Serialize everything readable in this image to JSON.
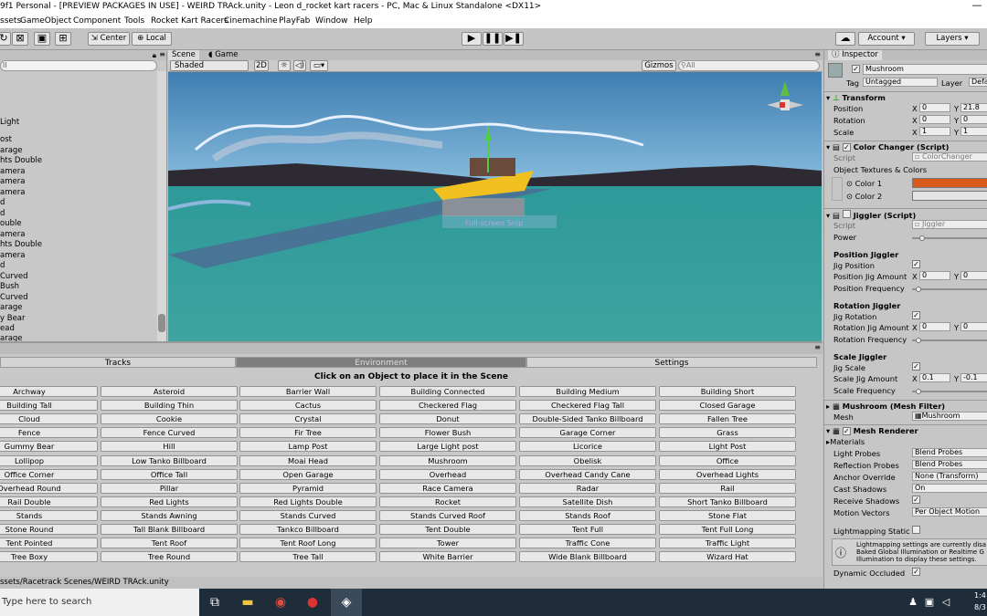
{
  "window": {
    "title": "9f1 Personal - [PREVIEW PACKAGES IN USE] - WEIRD TRAck.unity - Leon d_rocket kart racers - PC, Mac & Linux Standalone <DX11>",
    "minimize": "—"
  },
  "menu": [
    "ssets",
    "GameObject",
    "Component",
    "Tools",
    "Rocket Kart Racers",
    "Cinemachine",
    "PlayFab",
    "Window",
    "Help"
  ],
  "toolbar": {
    "center": "Center",
    "local": "Local",
    "account": "Account",
    "layers": "Layers",
    "dropdown_arrow": "▾"
  },
  "hierarchy": {
    "search_placeholder": "ll",
    "items": [
      "Light",
      "ost",
      "arage",
      "hts Double",
      "amera",
      "amera",
      "amera",
      "d",
      "d",
      "ouble",
      "amera",
      "hts Double",
      "amera",
      "d",
      "Curved",
      "Bush",
      "Curved",
      "arage",
      "y Bear",
      "ead",
      "arage"
    ]
  },
  "scene": {
    "tab_scene": "Scene",
    "tab_game": "Game",
    "shaded": "Shaded",
    "mode_2d": "2D",
    "gizmos": "Gizmos",
    "search_placeholder": "All",
    "hint_text": "Full-screen Snip"
  },
  "env_panel": {
    "tabs": [
      "Tracks",
      "Environment",
      "Settings"
    ],
    "instruction": "Click on an Object to place it in the Scene",
    "objects": [
      "Archway",
      "Asteroid",
      "Barrier Wall",
      "Building Connected",
      "Building Medium",
      "Building Short",
      "Building Tall",
      "Building Thin",
      "Cactus",
      "Checkered Flag",
      "Checkered Flag Tall",
      "Closed Garage",
      "Cloud",
      "Cookie",
      "Crystal",
      "Donut",
      "Double-Sided Tanko Billboard",
      "Fallen Tree",
      "Fence",
      "Fence Curved",
      "Fir Tree",
      "Flower Bush",
      "Garage Corner",
      "Grass",
      "Gummy Bear",
      "Hill",
      "Lamp Post",
      "Large Light post",
      "Licorice",
      "Light Post",
      "Lollipop",
      "Low Tanko Billboard",
      "Moai Head",
      "Mushroom",
      "Obelisk",
      "Office",
      "Office Corner",
      "Office Tall",
      "Open Garage",
      "Overhead",
      "Overhead Candy Cane",
      "Overhead Lights",
      "Overhead Round",
      "Pillar",
      "Pyramid",
      "Race Camera",
      "Radar",
      "Rail",
      "Rail Double",
      "Red Lights",
      "Red Lights Double",
      "Rocket",
      "Satellite Dish",
      "Short Tanko Billboard",
      "Stands",
      "Stands Awning",
      "Stands Curved",
      "Stands Curved Roof",
      "Stands Roof",
      "Stone Flat",
      "Stone Round",
      "Tall Blank Billboard",
      "Tankco Billboard",
      "Tent Double",
      "Tent Full",
      "Tent Full Long",
      "Tent Pointed",
      "Tent Roof",
      "Tent Roof Long",
      "Tower",
      "Traffic Cone",
      "Traffic Light",
      "Tree Boxy",
      "Tree Round",
      "Tree Tall",
      "White Barrier",
      "Wide Blank Billboard",
      "Wizard Hat"
    ]
  },
  "status": {
    "path": "ssets/Racetrack Scenes/WEIRD TRAck.unity"
  },
  "taskbar": {
    "search": "Type here to search",
    "time": "1:4",
    "date": "8/3"
  },
  "inspector": {
    "tab": "Inspector",
    "object_name": "Mushroom",
    "tag_label": "Tag",
    "tag_value": "Untagged",
    "layer_label": "Layer",
    "layer_value": "Defa",
    "transform": {
      "title": "Transform",
      "position": "Position",
      "rotation": "Rotation",
      "scale": "Scale",
      "pos_x": "0",
      "pos_y": "21.8",
      "rot_x": "0",
      "rot_y": "0",
      "scale_x": "1",
      "scale_y": "1"
    },
    "color_changer": {
      "title": "Color Changer (Script)",
      "script_label": "Script",
      "script_value": "ColorChanger",
      "textures": "Object Textures & Colors",
      "color1": "Color 1",
      "color2": "Color 2",
      "color1_hex": "#d9581c",
      "color2_hex": "#e3e3e3"
    },
    "jiggler": {
      "title": "Jiggler (Script)",
      "script_label": "Script",
      "script_value": "Jiggler",
      "power": "Power",
      "pos_title": "Position Jiggler",
      "jig_position": "Jig Position",
      "pos_amount": "Position Jig Amount",
      "pos_freq": "Position Frequency",
      "pos_amount_x": "0",
      "pos_amount_y": "0",
      "rot_title": "Rotation Jiggler",
      "jig_rotation": "Jig Rotation",
      "rot_amount": "Rotation Jig Amount",
      "rot_freq": "Rotation Frequency",
      "rot_amount_x": "0",
      "rot_amount_y": "0",
      "scale_title": "Scale Jiggler",
      "jig_scale": "Jig Scale",
      "scale_amount": "Scale Jig Amount",
      "scale_freq": "Scale Frequency",
      "scale_amount_x": "0.1",
      "scale_amount_y": "-0.1"
    },
    "mesh_filter": {
      "title": "Mushroom (Mesh Filter)",
      "mesh_label": "Mesh",
      "mesh_value": "Mushroom"
    },
    "mesh_renderer": {
      "title": "Mesh Renderer",
      "materials": "Materials",
      "light_probes": "Light Probes",
      "light_probes_v": "Blend Probes",
      "reflection_probes": "Reflection Probes",
      "reflection_probes_v": "Blend Probes",
      "anchor_override": "Anchor Override",
      "anchor_override_v": "None (Transform)",
      "cast_shadows": "Cast Shadows",
      "cast_shadows_v": "On",
      "receive_shadows": "Receive Shadows",
      "motion_vectors": "Motion Vectors",
      "motion_vectors_v": "Per Object Motion",
      "lightmap_static": "Lightmapping Static",
      "info": "Lightmapping settings are currently disa Baked Global Illumination or Realtime G Illumination to display these settings.",
      "dynamic_occluded": "Dynamic Occluded"
    }
  }
}
